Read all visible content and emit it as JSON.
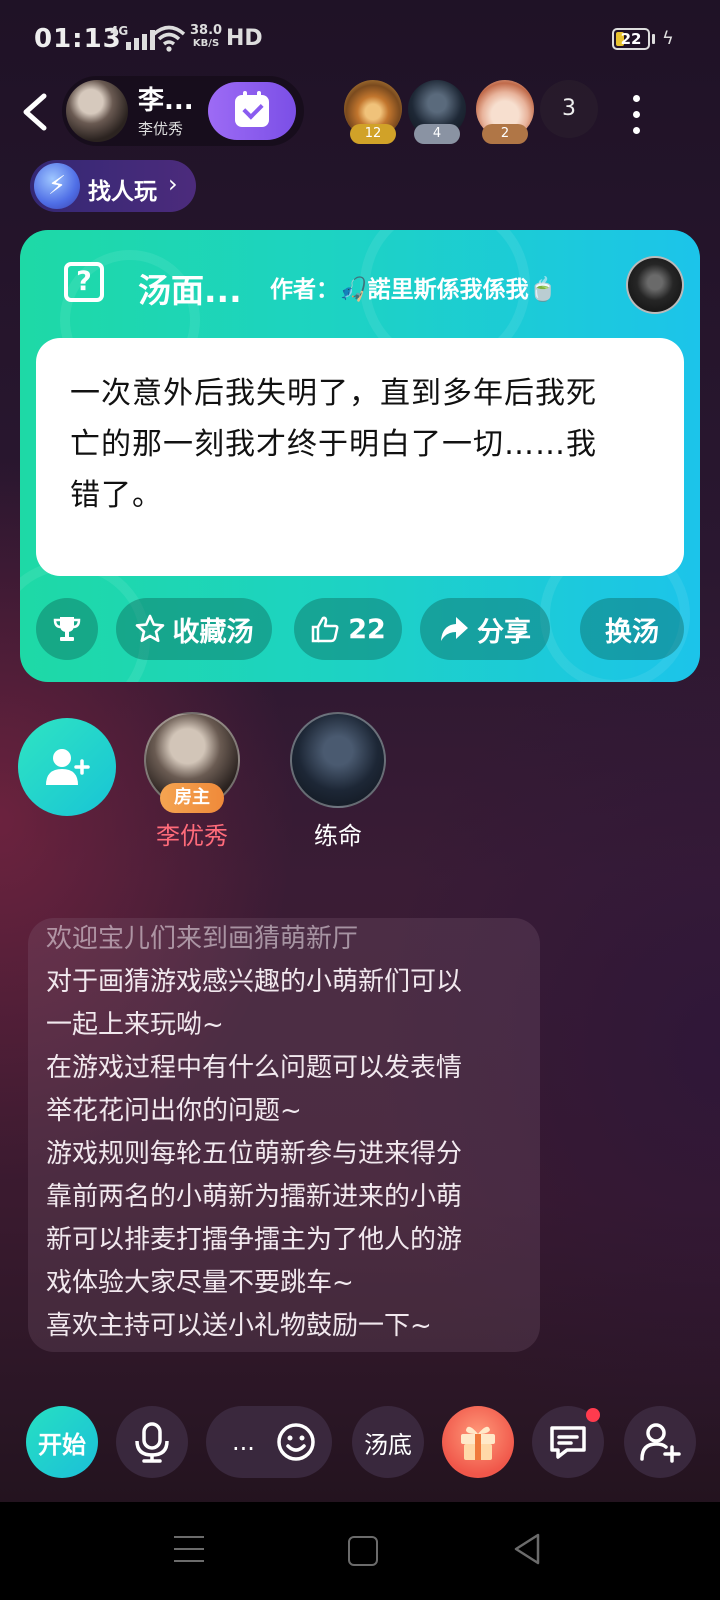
{
  "status_bar": {
    "time": "01:13",
    "network": "4G",
    "speed_top": "38.0",
    "speed_unit": "KB/S",
    "hd": "HD",
    "battery": "22"
  },
  "header": {
    "host_name": "李...",
    "host_subtitle": "李优秀",
    "viewers": [
      {
        "count": "12"
      },
      {
        "count": "4"
      },
      {
        "count": "2"
      }
    ],
    "viewer_total": "3"
  },
  "find_players": {
    "label": "找人玩",
    "chevron": "›"
  },
  "soup_card": {
    "title": "汤面...",
    "author": "作者：🎣諾里斯係我係我🍵",
    "puzzle_lines": [
      "一次意外后我失明了，直到多年后我死",
      "亡的那一刻我才终于明白了一切……我",
      "错了。"
    ],
    "actions": {
      "favorite": "收藏汤",
      "likes": "22",
      "share": "分享",
      "change": "换汤"
    },
    "colors": {
      "start": "#1ed9a6",
      "end": "#1cc4ea"
    }
  },
  "seats": [
    {
      "name": "李优秀",
      "badge": "房主",
      "name_color": "#ff6b7a"
    },
    {
      "name": "练命"
    }
  ],
  "announcement": {
    "lines": [
      "欢迎宝儿们来到画猜萌新厅",
      "对于画猜游戏感兴趣的小萌新们可以",
      "一起上来玩呦~",
      "在游戏过程中有什么问题可以发表情",
      "举花花问出你的问题~",
      "游戏规则每轮五位萌新参与进来得分",
      "靠前两名的小萌新为擂新进来的小萌",
      "新可以排麦打擂争擂主为了他人的游",
      "戏体验大家尽量不要跳车~",
      "喜欢主持可以送小礼物鼓励一下~"
    ]
  },
  "toolbar": {
    "start": "开始",
    "chat_placeholder": "...",
    "answer": "汤底"
  },
  "icons": [
    "back-arrow-icon",
    "checkin-calendar-icon",
    "more-vertical-icon",
    "lightning-icon",
    "question-icon",
    "trophy-icon",
    "star-icon",
    "thumbs-up-icon",
    "share-arrow-icon",
    "add-user-icon",
    "mic-icon",
    "emoji-icon",
    "gift-icon",
    "message-icon",
    "add-friend-icon"
  ]
}
